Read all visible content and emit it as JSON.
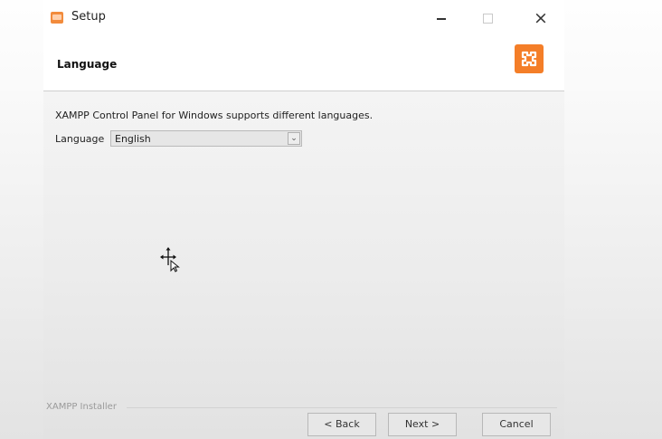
{
  "window": {
    "title": "Setup",
    "controls": {
      "minimize": "minimize",
      "maximize": "maximize",
      "close": "×"
    }
  },
  "header": {
    "title": "Language",
    "logo_icon": "xampp-logo-icon"
  },
  "content": {
    "description": "XAMPP Control Panel for Windows supports different languages.",
    "language_label": "Language",
    "language_value": "English",
    "dropdown_arrow": "⌄"
  },
  "footer": {
    "installer_label": "XAMPP Installer",
    "back_label": "< Back",
    "next_label": "Next >",
    "cancel_label": "Cancel"
  },
  "colors": {
    "accent": "#f47e28",
    "background": "#ececec"
  }
}
